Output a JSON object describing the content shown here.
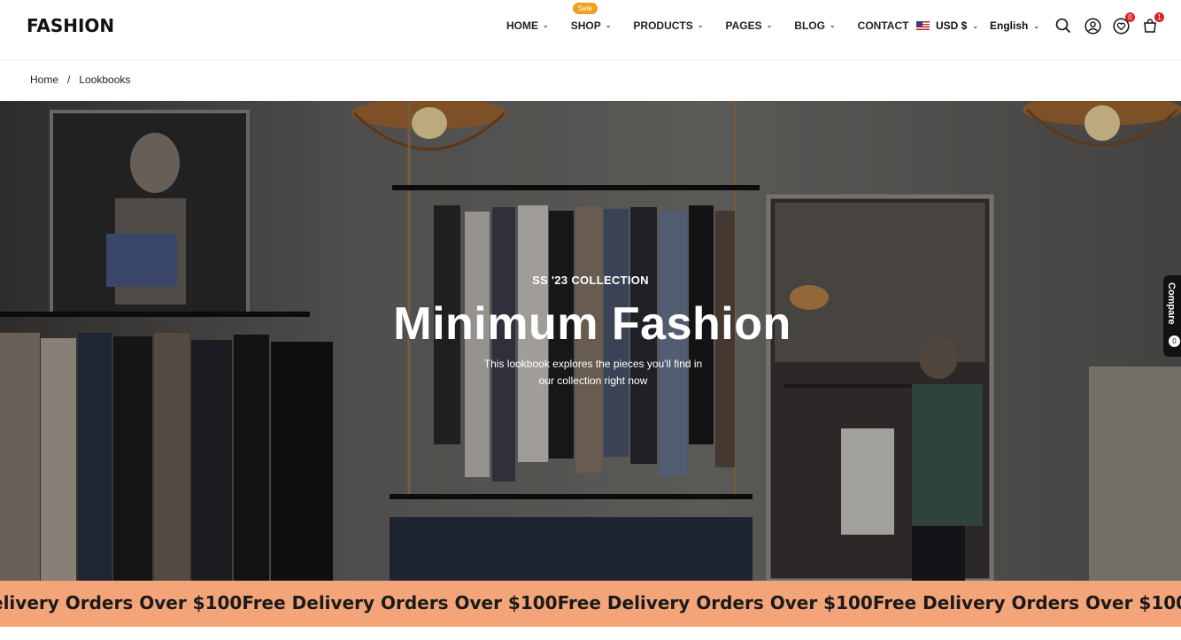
{
  "header": {
    "logo": "FASHION",
    "nav": [
      {
        "label": "HOME"
      },
      {
        "label": "SHOP",
        "badge": "Sale"
      },
      {
        "label": "PRODUCTS"
      },
      {
        "label": "PAGES"
      },
      {
        "label": "BLOG"
      },
      {
        "label": "CONTACT"
      }
    ],
    "currency": "USD $",
    "language": "English",
    "wishlist_count": "0",
    "cart_count": "1"
  },
  "breadcrumb": {
    "home": "Home",
    "separator": "/",
    "current": "Lookbooks"
  },
  "hero": {
    "subtitle": "SS '23 COLLECTION",
    "title": "Minimum Fashion",
    "description": "This lookbook explores the pieces you'll find in our collection right now"
  },
  "compare": {
    "label": "Compare",
    "count": "0"
  },
  "marquee": {
    "text": "Free Delivery Orders Over $100",
    "leading_text": "elivery Orders Over $100"
  },
  "colors": {
    "sale_badge": "#f0a020",
    "count_badge": "#e01e2c",
    "marquee_bg": "#f3a478"
  }
}
